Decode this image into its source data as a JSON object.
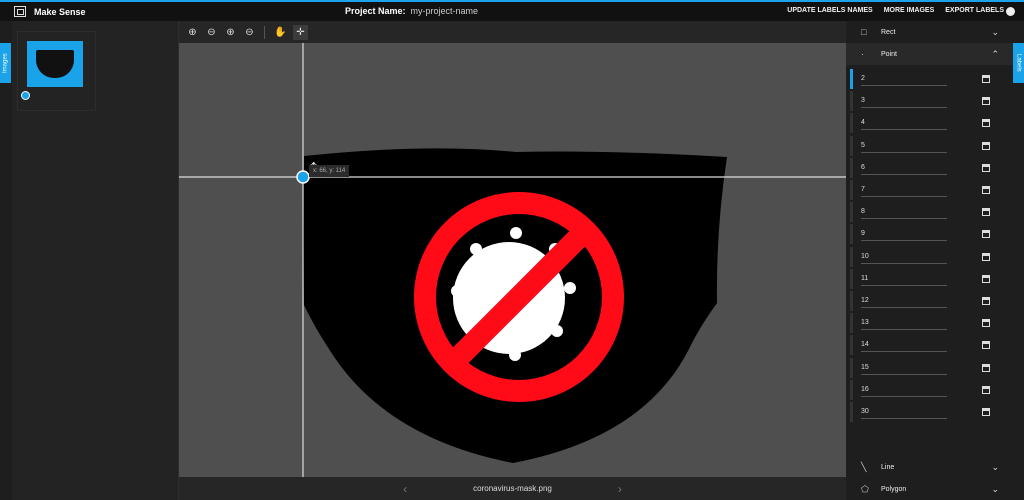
{
  "app": {
    "name": "Make Sense"
  },
  "project": {
    "label": "Project Name:",
    "name": "my-project-name"
  },
  "menu": [
    "UPDATE LABELS NAMES",
    "MORE IMAGES",
    "EXPORT LABELS"
  ],
  "side_tabs": {
    "left": "Images",
    "right": "Labels"
  },
  "editor": {
    "filename": "coronavirus-mask.png",
    "coordinates": "x: 66, y: 114",
    "tools": [
      "zoom-in-icon",
      "zoom-out-icon",
      "zoom-fit-icon",
      "zoom-reset-icon",
      "hand-icon",
      "crosshair-icon"
    ]
  },
  "label_sections": {
    "rect": "Rect",
    "point": "Point",
    "line": "Line",
    "polygon": "Polygon"
  },
  "point_labels": [
    "2",
    "3",
    "4",
    "5",
    "6",
    "7",
    "8",
    "9",
    "10",
    "11",
    "12",
    "13",
    "14",
    "15",
    "16",
    "30"
  ],
  "colors": {
    "accent": "#1aa3e8",
    "mask": "#000000",
    "forbidden": "#ff0b18"
  }
}
